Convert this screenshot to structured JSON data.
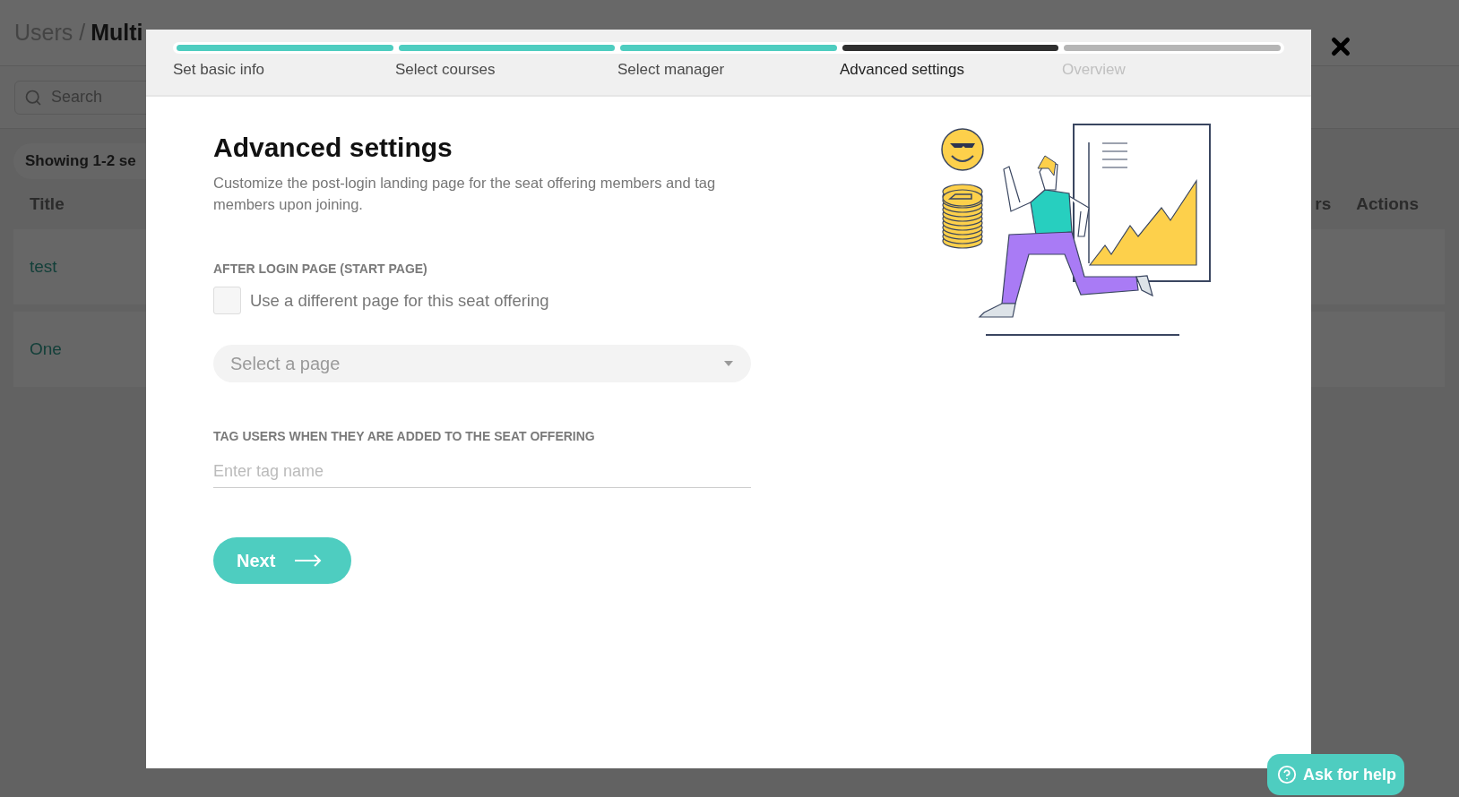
{
  "page": {
    "breadcrumb": {
      "parent": "Users /",
      "current": "Multi"
    },
    "search": {
      "placeholder": "Search"
    },
    "showing": "Showing 1-2 se",
    "columns": [
      "Title",
      "rs",
      "Actions"
    ],
    "rows": [
      "test",
      "One"
    ]
  },
  "modal": {
    "steps": [
      {
        "label": "Set basic info",
        "completed": true,
        "selected": false
      },
      {
        "label": "Select courses",
        "completed": true,
        "selected": false
      },
      {
        "label": "Select manager",
        "completed": true,
        "selected": false
      },
      {
        "label": "Advanced settings",
        "completed": false,
        "selected": true
      },
      {
        "label": "Overview",
        "completed": false,
        "selected": false
      }
    ],
    "title": "Advanced settings",
    "description": "Customize the post-login landing page for the seat offering members and tag members upon joining.",
    "start_page": {
      "heading": "AFTER LOGIN PAGE (START PAGE)",
      "checkbox": {
        "label": "Use a different page for this seat offering",
        "checked": false
      },
      "select": {
        "placeholder": "Select a page"
      }
    },
    "tags": {
      "heading": "TAG USERS WHEN THEY ARE ADDED TO THE SEAT OFFERING",
      "input": {
        "placeholder": "Enter tag name"
      }
    },
    "next_button": "Next"
  },
  "help_button": "Ask for help"
}
